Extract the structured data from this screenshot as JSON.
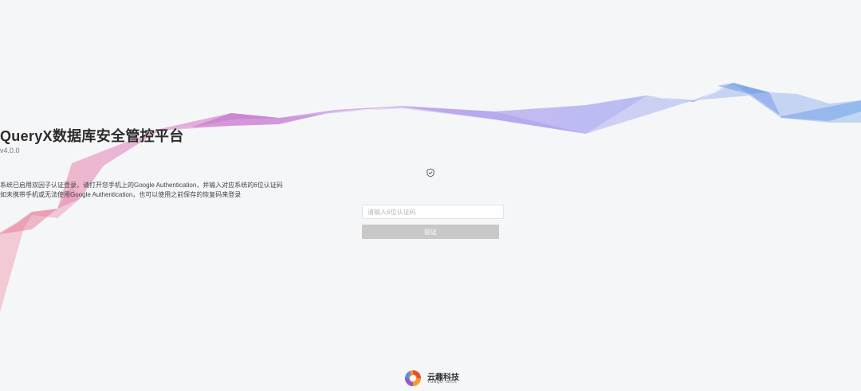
{
  "login": {
    "title": "QueryX数据库安全管控平台",
    "version": "v4.0.0",
    "description_line1": "系统已启用双因子认证登录，请打开您手机上的Google Authentication，并输入对应系统的6位认证码",
    "description_line2": "如未携带手机或无法使用Google Authentication，也可以使用之前保存的恢复码来登录",
    "code_placeholder": "请输入6位认证码",
    "code_value": "",
    "verify_label": "验证",
    "verify_enabled": false
  },
  "footer": {
    "brand_cn": "云趣科技",
    "brand_en": "YUNQU TECH"
  },
  "icons": {
    "shield": "shield-check-icon",
    "logo": "yunqu-logo-icon"
  },
  "colors": {
    "background": "#f5f6f8",
    "button_disabled": "#c8c8c8",
    "ribbon_start": "#f0a0a8",
    "ribbon_mid": "#c890d8",
    "ribbon_end": "#8ab4ec"
  }
}
